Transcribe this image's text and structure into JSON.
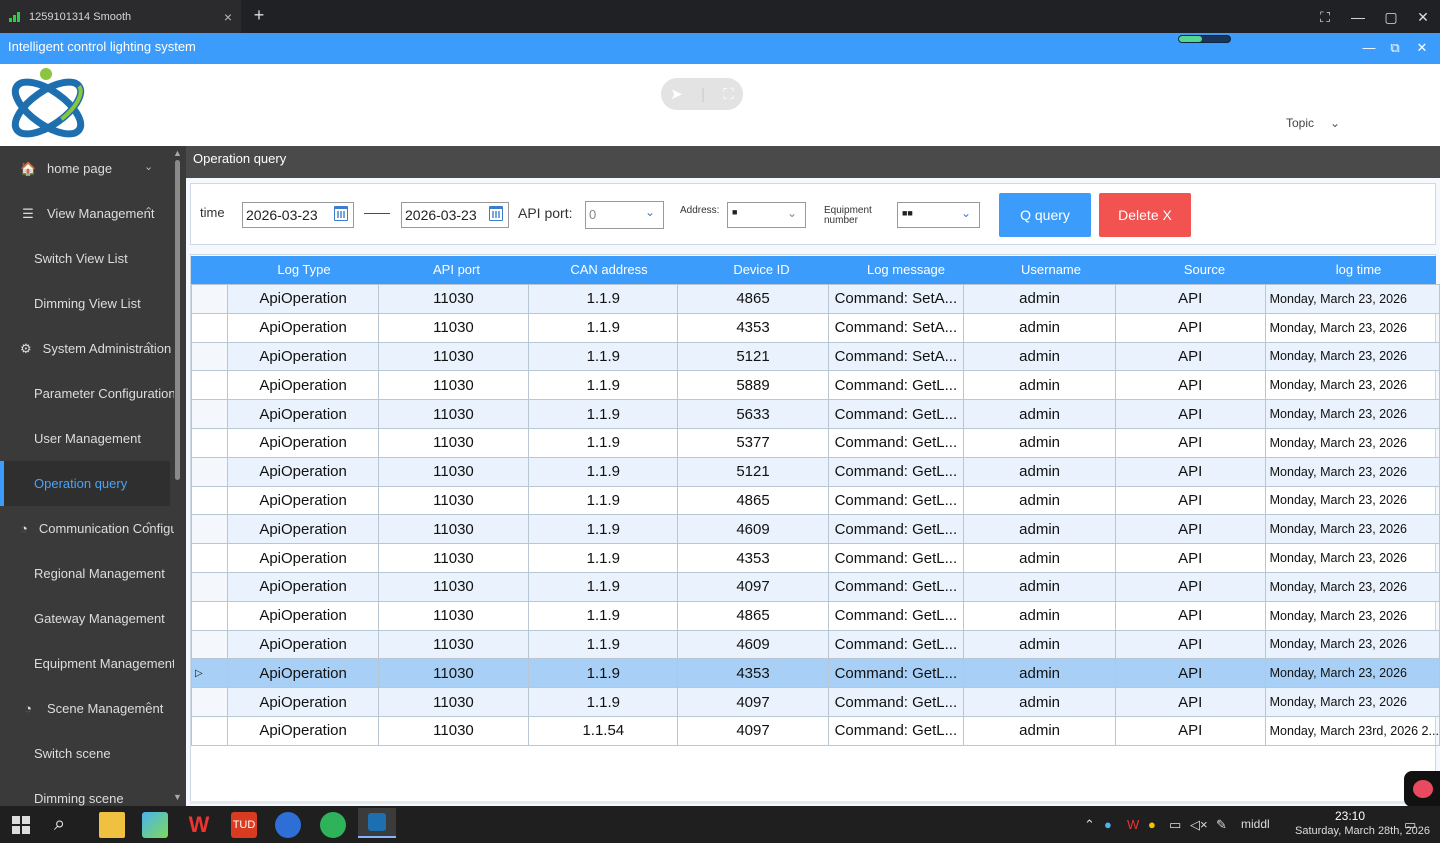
{
  "viewer": {
    "tab_title": "1259101314 Smooth",
    "tab_close": "×",
    "new_tab": "+",
    "controls": [
      "⛶",
      "—",
      "▢",
      "✕"
    ]
  },
  "app": {
    "title": "Intelligent control lighting system",
    "progress": 0.45,
    "window_controls": [
      "—",
      "⧉",
      "✕"
    ]
  },
  "header": {
    "topic_label": "Topic",
    "topic_chevron": "⌄"
  },
  "sidebar": {
    "items": [
      {
        "label": "home page",
        "icon": "🏠",
        "type": "top",
        "chevron": "⌄"
      },
      {
        "label": "View Management",
        "icon": "☰",
        "type": "top",
        "chevron": "⌃"
      },
      {
        "label": "Switch View List",
        "type": "sub"
      },
      {
        "label": "Dimming View List",
        "type": "sub"
      },
      {
        "label": "System Administration",
        "icon": "⚙",
        "type": "top",
        "chevron": "⌃"
      },
      {
        "label": "Parameter Configuration",
        "type": "sub"
      },
      {
        "label": "User Management",
        "type": "sub"
      },
      {
        "label": "Operation query",
        "type": "sub",
        "active": true
      },
      {
        "label": "Communication Configuration",
        "icon": "◔",
        "type": "top",
        "chevron": "⌃"
      },
      {
        "label": "Regional Management",
        "type": "sub"
      },
      {
        "label": "Gateway Management",
        "type": "sub"
      },
      {
        "label": "Equipment Management",
        "type": "sub"
      },
      {
        "label": "Scene Management",
        "icon": "◔",
        "type": "top",
        "chevron": "⌃"
      },
      {
        "label": "Switch scene",
        "type": "sub"
      },
      {
        "label": "Dimming scene",
        "type": "sub"
      }
    ]
  },
  "page": {
    "title": "Operation query"
  },
  "filter": {
    "time_label": "time",
    "date_from": "2026-03-23",
    "date_to": "2026-03-23",
    "separator": "——",
    "api_port_label": "API port:",
    "api_port_value": "0",
    "address_label": "Address:",
    "address_value": "■",
    "equipment_label": "Equipment number",
    "equipment_value": "■■",
    "query_button": "Q query",
    "delete_button": "Delete X"
  },
  "table": {
    "columns": [
      "Log Type",
      "API port",
      "CAN address",
      "Device ID",
      "Log message",
      "Username",
      "Source",
      "log time"
    ],
    "rows": [
      [
        "ApiOperation",
        "11030",
        "1.1.9",
        "4865",
        "Command: SetA...",
        "admin",
        "API",
        "Monday, March 23, 2026"
      ],
      [
        "ApiOperation",
        "11030",
        "1.1.9",
        "4353",
        "Command: SetA...",
        "admin",
        "API",
        "Monday, March 23, 2026"
      ],
      [
        "ApiOperation",
        "11030",
        "1.1.9",
        "5121",
        "Command: SetA...",
        "admin",
        "API",
        "Monday, March 23, 2026"
      ],
      [
        "ApiOperation",
        "11030",
        "1.1.9",
        "5889",
        "Command: GetL...",
        "admin",
        "API",
        "Monday, March 23, 2026"
      ],
      [
        "ApiOperation",
        "11030",
        "1.1.9",
        "5633",
        "Command: GetL...",
        "admin",
        "API",
        "Monday, March 23, 2026"
      ],
      [
        "ApiOperation",
        "11030",
        "1.1.9",
        "5377",
        "Command: GetL...",
        "admin",
        "API",
        "Monday, March 23, 2026"
      ],
      [
        "ApiOperation",
        "11030",
        "1.1.9",
        "5121",
        "Command: GetL...",
        "admin",
        "API",
        "Monday, March 23, 2026"
      ],
      [
        "ApiOperation",
        "11030",
        "1.1.9",
        "4865",
        "Command: GetL...",
        "admin",
        "API",
        "Monday, March 23, 2026"
      ],
      [
        "ApiOperation",
        "11030",
        "1.1.9",
        "4609",
        "Command: GetL...",
        "admin",
        "API",
        "Monday, March 23, 2026"
      ],
      [
        "ApiOperation",
        "11030",
        "1.1.9",
        "4353",
        "Command: GetL...",
        "admin",
        "API",
        "Monday, March 23, 2026"
      ],
      [
        "ApiOperation",
        "11030",
        "1.1.9",
        "4097",
        "Command: GetL...",
        "admin",
        "API",
        "Monday, March 23, 2026"
      ],
      [
        "ApiOperation",
        "11030",
        "1.1.9",
        "4865",
        "Command: GetL...",
        "admin",
        "API",
        "Monday, March 23, 2026"
      ],
      [
        "ApiOperation",
        "11030",
        "1.1.9",
        "4609",
        "Command: GetL...",
        "admin",
        "API",
        "Monday, March 23, 2026"
      ],
      [
        "ApiOperation",
        "11030",
        "1.1.9",
        "4353",
        "Command: GetL...",
        "admin",
        "API",
        "Monday, March 23, 2026"
      ],
      [
        "ApiOperation",
        "11030",
        "1.1.9",
        "4097",
        "Command: GetL...",
        "admin",
        "API",
        "Monday, March 23, 2026"
      ],
      [
        "ApiOperation",
        "11030",
        "1.1.54",
        "4097",
        "Command: GetL...",
        "admin",
        "API",
        "Monday, March 23rd, 2026 2..."
      ]
    ],
    "selected_row": 13,
    "row_marker": "▷"
  },
  "taskbar": {
    "tray_text": "middl",
    "time": "23:10",
    "date": "Saturday, March 28th, 2026"
  },
  "colors": {
    "accent": "#3c9cfb",
    "danger": "#f25250",
    "sidebar": "#3a3a3a",
    "active_text": "#4aa3f5"
  }
}
